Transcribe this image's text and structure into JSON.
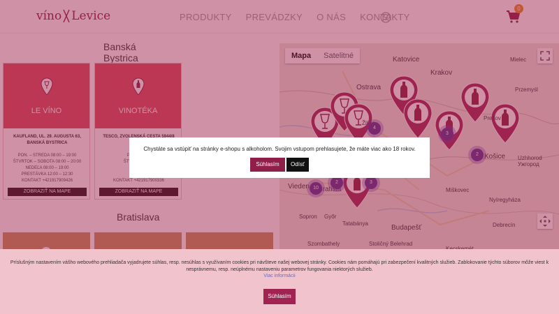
{
  "header": {
    "logo_left": "víno",
    "logo_right": "Levice",
    "nav": [
      "PRODUKTY",
      "PREVÁDZKY",
      "O NÁS",
      "KONTAKTY"
    ],
    "cart_count": "0"
  },
  "sections": {
    "banska": "Banská Bystrica",
    "bratislava": "Bratislava"
  },
  "stores": [
    {
      "name": "LE VÍNO",
      "address_1": "KAUFLAND, UL. 29. AUGUSTA 63,",
      "address_2": "BANSKÁ BYSTRICA",
      "hours_1": "PON. – STREDA 08:00 – 19:00",
      "hours_2": "ŠTVRTOK – SOBOTA 08:00 – 20:00",
      "hours_3": "NEDEĽA 08:00 – 19:00",
      "hours_4": "PRESTÁVKA 12:00 – 12:30",
      "hours_5": "KONTAKT +421917909426",
      "button": "ZOBRAZIŤ NA MAPE"
    },
    {
      "name": "VINOTÉKA",
      "address_1": "TESCO, ZVOLENSKÁ CESTA 5944/8",
      "address_2": "BANS",
      "hours_1": "PON. – STR",
      "hours_2": "ŠTVRTOK – SO",
      "hours_3": "NEDE",
      "hours_4": "PRESTÁ",
      "hours_5": "KONTAKT +421917900336",
      "button": "ZOBRAZIŤ NA MAPE"
    }
  ],
  "map": {
    "tab_map": "Mapa",
    "tab_satellite": "Satelitné",
    "labels": [
      {
        "text": "Katovice",
        "big": true
      },
      {
        "text": "Krakov",
        "big": true
      },
      {
        "text": "Mielec",
        "big": false
      },
      {
        "text": "Ostrava",
        "big": true
      },
      {
        "text": "Žilina",
        "big": false
      },
      {
        "text": "Przemyśl",
        "big": false
      },
      {
        "text": "Prešov",
        "big": false
      },
      {
        "text": "Košice",
        "big": true
      },
      {
        "text": "Uzhhorod",
        "big": false
      },
      {
        "text": "Ужгород",
        "big": false
      },
      {
        "text": "Vieden",
        "big": true
      },
      {
        "text": "Bratisla",
        "big": true
      },
      {
        "text": "Miškovec",
        "big": false
      },
      {
        "text": "Nyíregyháza",
        "big": false
      },
      {
        "text": "Tatabánya",
        "big": false
      },
      {
        "text": "Budapešť",
        "big": true
      },
      {
        "text": "Debrecín",
        "big": false
      },
      {
        "text": "Győr",
        "big": false
      },
      {
        "text": "Szombathely",
        "big": false
      },
      {
        "text": "Stoličný Belehrad",
        "big": false
      },
      {
        "text": "Sopron",
        "big": false
      },
      {
        "text": "Kecskemét",
        "big": false
      }
    ],
    "clusters": [
      "4",
      "3",
      "2",
      "10",
      "2",
      "3"
    ]
  },
  "age_modal": {
    "text": "Chystáte sa vstúpiť na stránky e-shopu s alkoholom. Svojim vstupom prehlasujete, že máte viac ako 18 rokov.",
    "yes": "Súhlasím",
    "no": "Odísť"
  },
  "cookie": {
    "text": "Príslušným nastavením vášho webového prehliadača vyjadrujete súhlas, resp. nesúhlas s využívaním cookies pri návšteve našej webovej stránky. Cookies nám pomáhajú pri zabezpečení kvalitných služieb. Zablokovanie týchto súborov môže viest k nesprávnemu, resp. neúplnému nastaveniu parametrov fungovania niektorých služieb.",
    "link": "Viac informácii",
    "button": "Súhlasím"
  },
  "colors": {
    "brand": "#8a1d3e",
    "store_red": "#d94b58",
    "overlay": "#9e244e",
    "cluster": "#5b2d8f"
  }
}
